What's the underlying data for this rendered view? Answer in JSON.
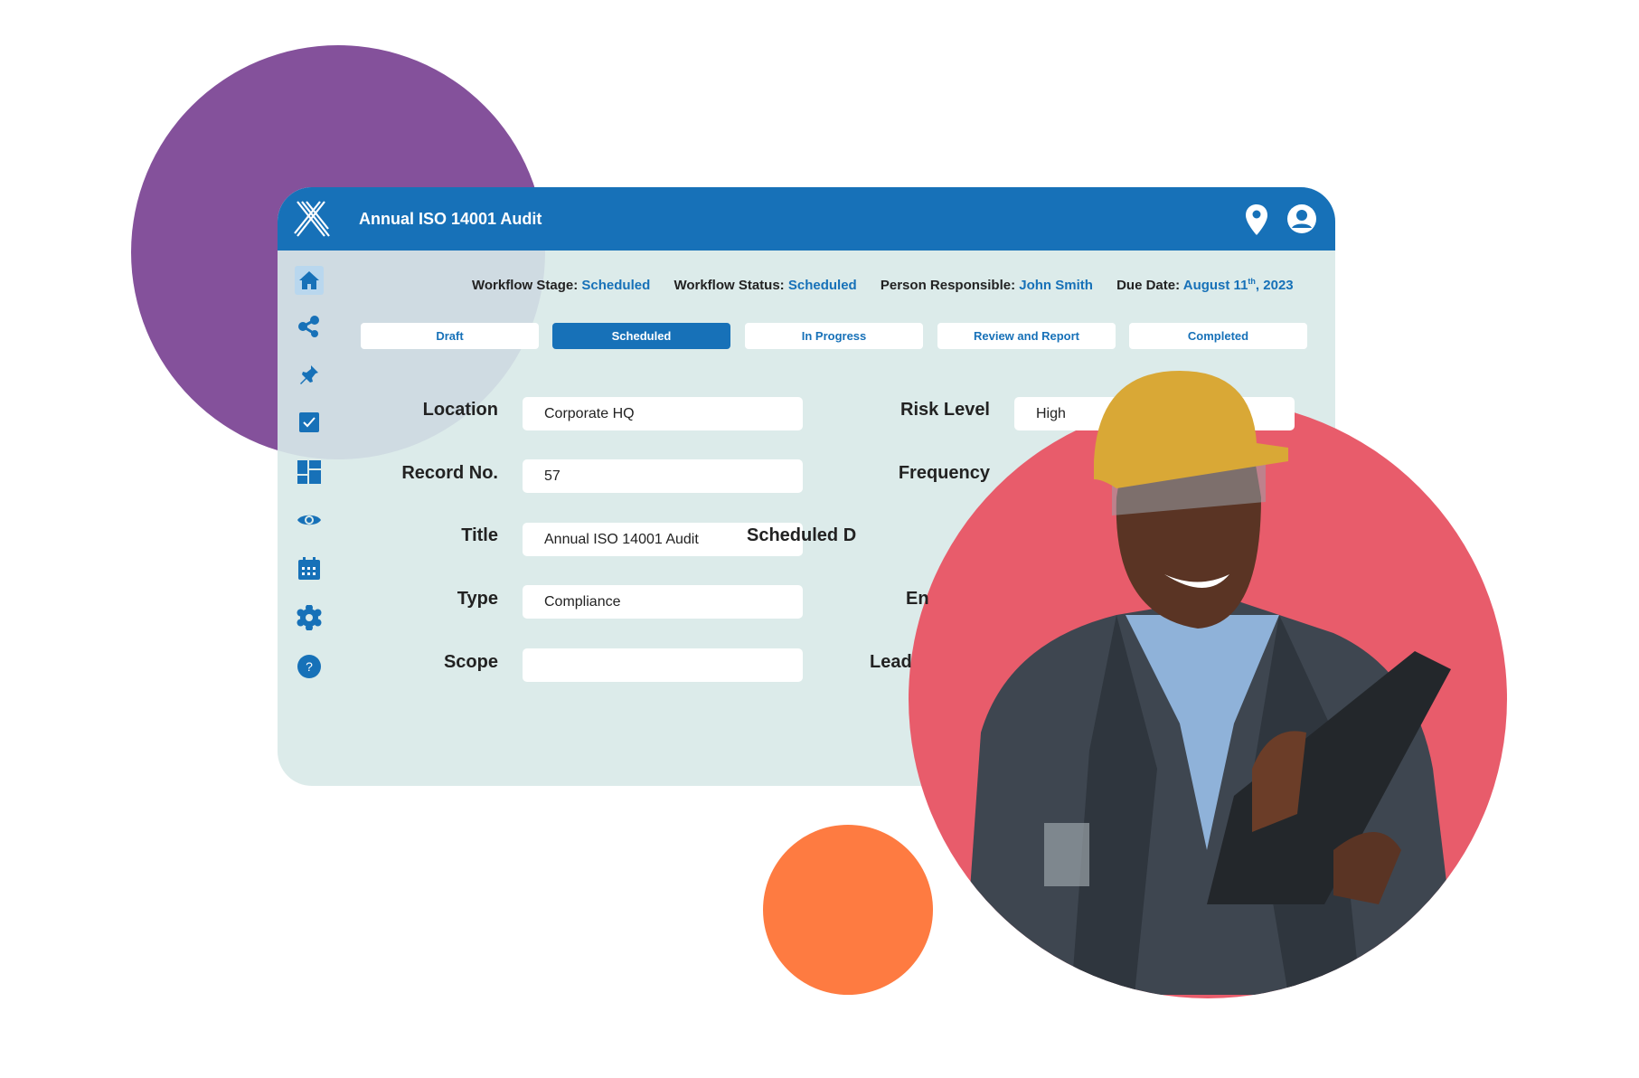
{
  "header": {
    "title": "Annual ISO 14001 Audit",
    "icons": [
      "location-pin-icon",
      "user-account-icon"
    ]
  },
  "sidebar": {
    "items": [
      {
        "icon": "home-icon",
        "active": true
      },
      {
        "icon": "share-icon"
      },
      {
        "icon": "pin-icon"
      },
      {
        "icon": "checkbox-icon"
      },
      {
        "icon": "dashboard-icon"
      },
      {
        "icon": "eye-icon"
      },
      {
        "icon": "calendar-icon"
      },
      {
        "icon": "gear-icon"
      },
      {
        "icon": "help-icon"
      }
    ]
  },
  "meta": {
    "stage_label": "Workflow Stage:",
    "stage": "Scheduled",
    "status_label": "Workflow Status:",
    "status": "Scheduled",
    "person_label": "Person Responsible:",
    "person": "John Smith",
    "due_label": "Due Date:",
    "due_month": "August 11",
    "due_sup": "th",
    "due_year": ", 2023"
  },
  "tabs": [
    {
      "label": "Draft"
    },
    {
      "label": "Scheduled",
      "selected": true
    },
    {
      "label": "In Progress"
    },
    {
      "label": "Review and Report"
    },
    {
      "label": "Completed"
    }
  ],
  "form_left": [
    {
      "label": "Location",
      "value": "Corporate HQ"
    },
    {
      "label": "Record No.",
      "value": "57"
    },
    {
      "label": "Title",
      "value": "Annual ISO 14001 Audit"
    },
    {
      "label": "Type",
      "value": "Compliance"
    },
    {
      "label": "Scope",
      "value": ""
    }
  ],
  "form_right": [
    {
      "label": "Risk Level",
      "value": "High"
    },
    {
      "label": "Frequency"
    },
    {
      "label": "Scheduled D"
    },
    {
      "label": "En"
    },
    {
      "label": "Lead"
    }
  ],
  "colors": {
    "brand": "#1771b8",
    "purple": "#84519b",
    "red": "#e85c6b",
    "orange": "#fe7b41",
    "panel": "#dcebea"
  }
}
